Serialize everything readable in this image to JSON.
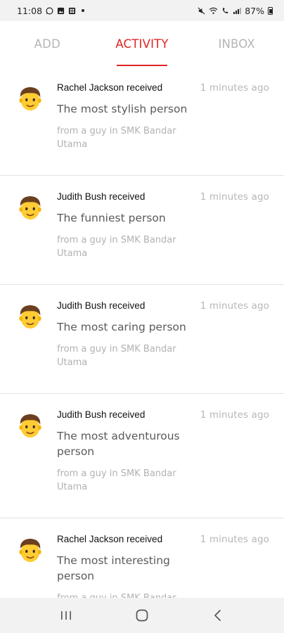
{
  "status_bar": {
    "time": "11:08",
    "battery": "87%"
  },
  "tabs": [
    {
      "label": "ADD",
      "active": false
    },
    {
      "label": "ACTIVITY",
      "active": true
    },
    {
      "label": "INBOX",
      "active": false
    }
  ],
  "accent_color": "#e02424",
  "activities": [
    {
      "recipient_line": "Rachel Jackson received",
      "time": "1 minutes ago",
      "title": "The most stylish person",
      "from": "from a guy in SMK Bandar Utama",
      "avatar_icon": "man-emoji-icon"
    },
    {
      "recipient_line": "Judith Bush received",
      "time": "1 minutes ago",
      "title": "The funniest person",
      "from": "from a guy in SMK Bandar Utama",
      "avatar_icon": "man-emoji-icon"
    },
    {
      "recipient_line": "Judith Bush received",
      "time": "1 minutes ago",
      "title": "The most caring person",
      "from": "from a guy in SMK Bandar Utama",
      "avatar_icon": "man-emoji-icon"
    },
    {
      "recipient_line": "Judith Bush received",
      "time": "1 minutes ago",
      "title": "The most adventurous person",
      "from": "from a guy in SMK Bandar Utama",
      "avatar_icon": "man-emoji-icon"
    },
    {
      "recipient_line": "Rachel Jackson received",
      "time": "1 minutes ago",
      "title": "The most interesting person",
      "from": "from a guy in SMK Bandar Utama",
      "avatar_icon": "man-emoji-icon"
    }
  ],
  "nav_bar": {
    "recents_icon": "recent-apps-icon",
    "home_icon": "home-icon",
    "back_icon": "back-icon"
  }
}
